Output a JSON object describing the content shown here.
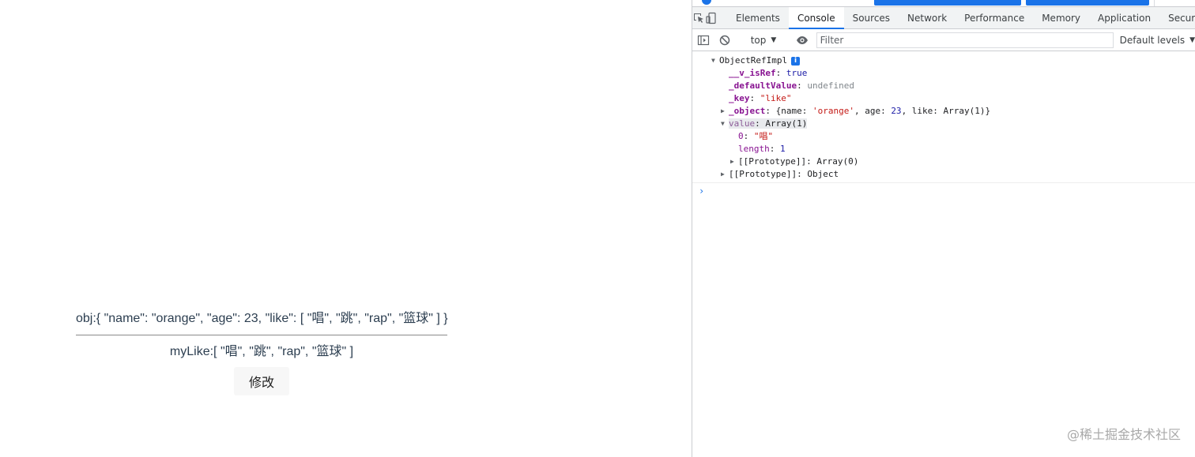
{
  "app": {
    "obj_text": "obj:{ \"name\": \"orange\", \"age\": 23, \"like\": [ \"唱\", \"跳\", \"rap\", \"篮球\" ] }",
    "mylike_text": "myLike:[ \"唱\", \"跳\", \"rap\", \"篮球\" ]",
    "modify_button_label": "修改"
  },
  "devtools": {
    "tabs": [
      {
        "label": "Elements",
        "active": false
      },
      {
        "label": "Console",
        "active": true
      },
      {
        "label": "Sources",
        "active": false
      },
      {
        "label": "Network",
        "active": false
      },
      {
        "label": "Performance",
        "active": false
      },
      {
        "label": "Memory",
        "active": false
      },
      {
        "label": "Application",
        "active": false
      },
      {
        "label": "Security",
        "active": false
      }
    ],
    "toolbar": {
      "context": "top",
      "filter_placeholder": "Filter",
      "levels": "Default levels"
    },
    "output": {
      "root_label": "ObjectRefImpl",
      "info_badge": "i",
      "rows": [
        {
          "key": "__v_isRef",
          "value": "true"
        },
        {
          "key": "_defaultValue",
          "value": "undefined"
        },
        {
          "key": "_key",
          "value": "\"like\""
        },
        {
          "key": "_object",
          "value_prefix": "{name: ",
          "value_name": "'orange'",
          "value_mid": ", age: ",
          "value_age": "23",
          "value_suffix": ", like: Array(1)}"
        },
        {
          "key": "value",
          "value": "Array(1)"
        }
      ],
      "value_children": [
        {
          "key": "0",
          "value": "\"唱\""
        },
        {
          "key": "length",
          "value": "1"
        },
        {
          "key": "[[Prototype]]",
          "value": "Array(0)"
        }
      ],
      "proto_row": {
        "key": "[[Prototype]]",
        "value": "Object"
      },
      "prompt": "›"
    }
  },
  "watermark": "@稀土掘金技术社区",
  "colors": {
    "accent": "#1a73e8",
    "property_purple": "#881391",
    "string_red": "#c41a16",
    "keyword_blue": "#1a1aa6"
  }
}
